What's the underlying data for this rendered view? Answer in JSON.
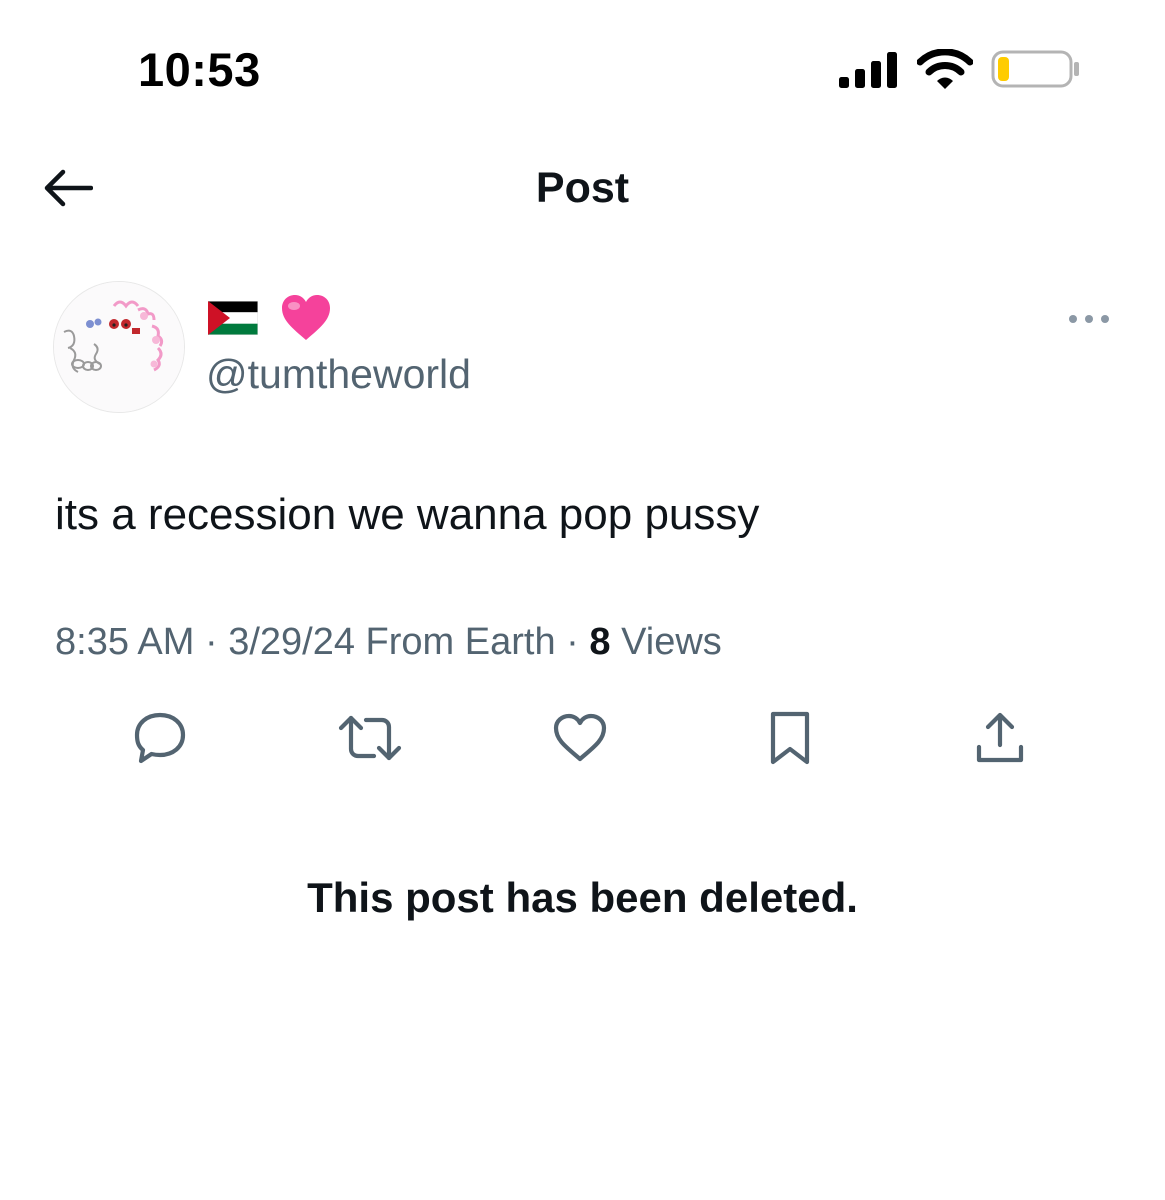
{
  "status_bar": {
    "time": "10:53",
    "icons": [
      "signal-icon",
      "wifi-icon",
      "battery-icon"
    ],
    "battery_level": 0.15,
    "battery_color": "#ffcc00"
  },
  "header": {
    "title": "Post",
    "back_icon": "back-arrow-icon"
  },
  "post": {
    "author": {
      "display_name_emoji": [
        "palestine-flag-icon",
        "pink-heart-icon"
      ],
      "handle": "@tumtheworld"
    },
    "text": "its a recession we wanna pop pussy",
    "meta": {
      "time": "8:35 AM",
      "sep1": " · ",
      "date": "3/29/24",
      "source": " From Earth",
      "sep2": " · ",
      "views_count": "8",
      "views_label": " Views"
    },
    "actions": [
      "reply-icon",
      "repost-icon",
      "like-icon",
      "bookmark-icon",
      "share-icon"
    ]
  },
  "notice": {
    "text": "This post has been deleted."
  },
  "colors": {
    "primary_text": "#0f1419",
    "secondary_text": "#536471",
    "background": "#ffffff",
    "accent_pink": "#f5429b"
  }
}
